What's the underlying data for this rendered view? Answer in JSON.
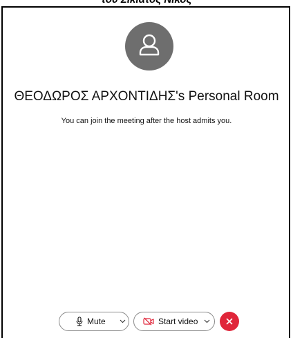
{
  "caption": "του Σικιάτος Νίκος",
  "room": {
    "title": "ΘΕΟΔΩΡΟΣ ΑΡΧΟΝΤΙΔΗΣ's Personal Room",
    "message": "You can join the meeting after the host admits you."
  },
  "avatar": {
    "icon": "user-icon",
    "color": "#6e6e6e"
  },
  "controls": {
    "mute_label": "Mute",
    "mute_icon": "microphone-icon",
    "video_label": "Start video",
    "video_icon": "video-off-icon",
    "leave_icon": "close-icon",
    "leave_color": "#e0263a"
  }
}
